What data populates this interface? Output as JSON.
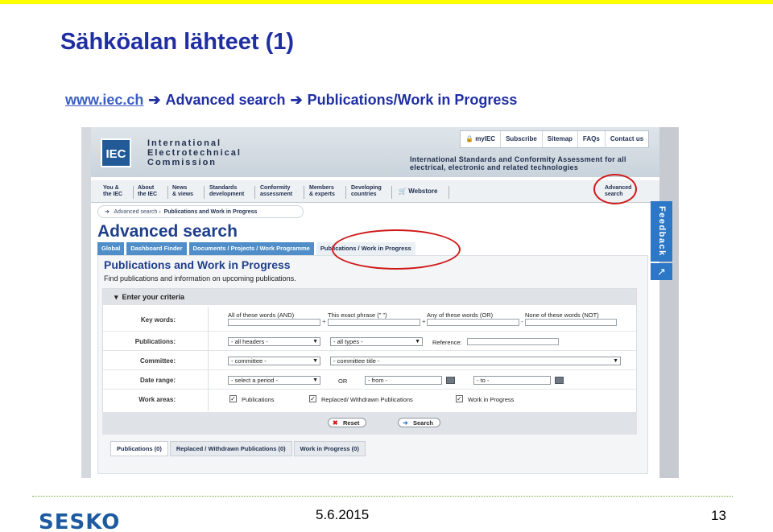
{
  "slide": {
    "title": "Sähköalan lähteet (1)",
    "path_link": "www.iec.ch",
    "path_sep": "➔",
    "path_step2": "Advanced search",
    "path_step3": "Publications/Work in Progress",
    "date": "5.6.2015",
    "page_number": "13",
    "logo": "SESKO"
  },
  "iec": {
    "logo": "IEC",
    "org_name": [
      "International",
      "Electrotechnical",
      "Commission"
    ],
    "top_links": [
      "myIEC",
      "Subscribe",
      "Sitemap",
      "FAQs",
      "Contact us"
    ],
    "tagline_1": "International Standards and Conformity Assessment for all",
    "tagline_2": "electrical, electronic and related technologies",
    "nav": [
      "You &\nthe IEC",
      "About\nthe IEC",
      "News\n& views",
      "Standards\ndevelopment",
      "Conformity\nassessment",
      "Members\n& experts",
      "Developing\ncountries",
      "Webstore",
      "Advanced\nsearch"
    ],
    "breadcrumb_1": "Advanced search",
    "breadcrumb_2": "Publications and Work in Progress",
    "heading": "Advanced search",
    "tabs": [
      "Global",
      "Dashboard Finder",
      "Documents / Projects / Work Programme",
      "Publications / Work in Progress"
    ],
    "section_title": "Publications and Work in Progress",
    "section_sub": "Find publications and information on upcoming publications.",
    "criteria_title": "Enter your criteria",
    "labels": {
      "keywords": "Key words:",
      "publications": "Publications:",
      "committee": "Committee:",
      "date_range": "Date range:",
      "work_areas": "Work areas:"
    },
    "kw_all": "All of these words (AND)",
    "kw_exact": "This exact phrase (\" \")",
    "kw_any": "Any of these words (OR)",
    "kw_none": "None of these words (NOT)",
    "sel_headers": "- all headers -",
    "sel_types": "- all types -",
    "reference_label": "Reference:",
    "sel_committee": "- committee -",
    "sel_committee_title": "- committee title -",
    "sel_period": "- select a period -",
    "or_label": "OR",
    "from_placeholder": "- from -",
    "to_placeholder": "- to -",
    "chk_publications": "Publications",
    "chk_replaced": "Replaced/ Withdrawn Publications",
    "chk_wip": "Work in Progress",
    "btn_reset": "Reset",
    "btn_search": "Search",
    "result_tabs": [
      "Publications (0)",
      "Replaced / Withdrawn Publications (0)",
      "Work in Progress (0)"
    ],
    "feedback": "Feedback"
  },
  "colors": {
    "title_blue": "#1f2fa3",
    "annotation_red": "#d01818",
    "iec_blue": "#2d77c7"
  }
}
